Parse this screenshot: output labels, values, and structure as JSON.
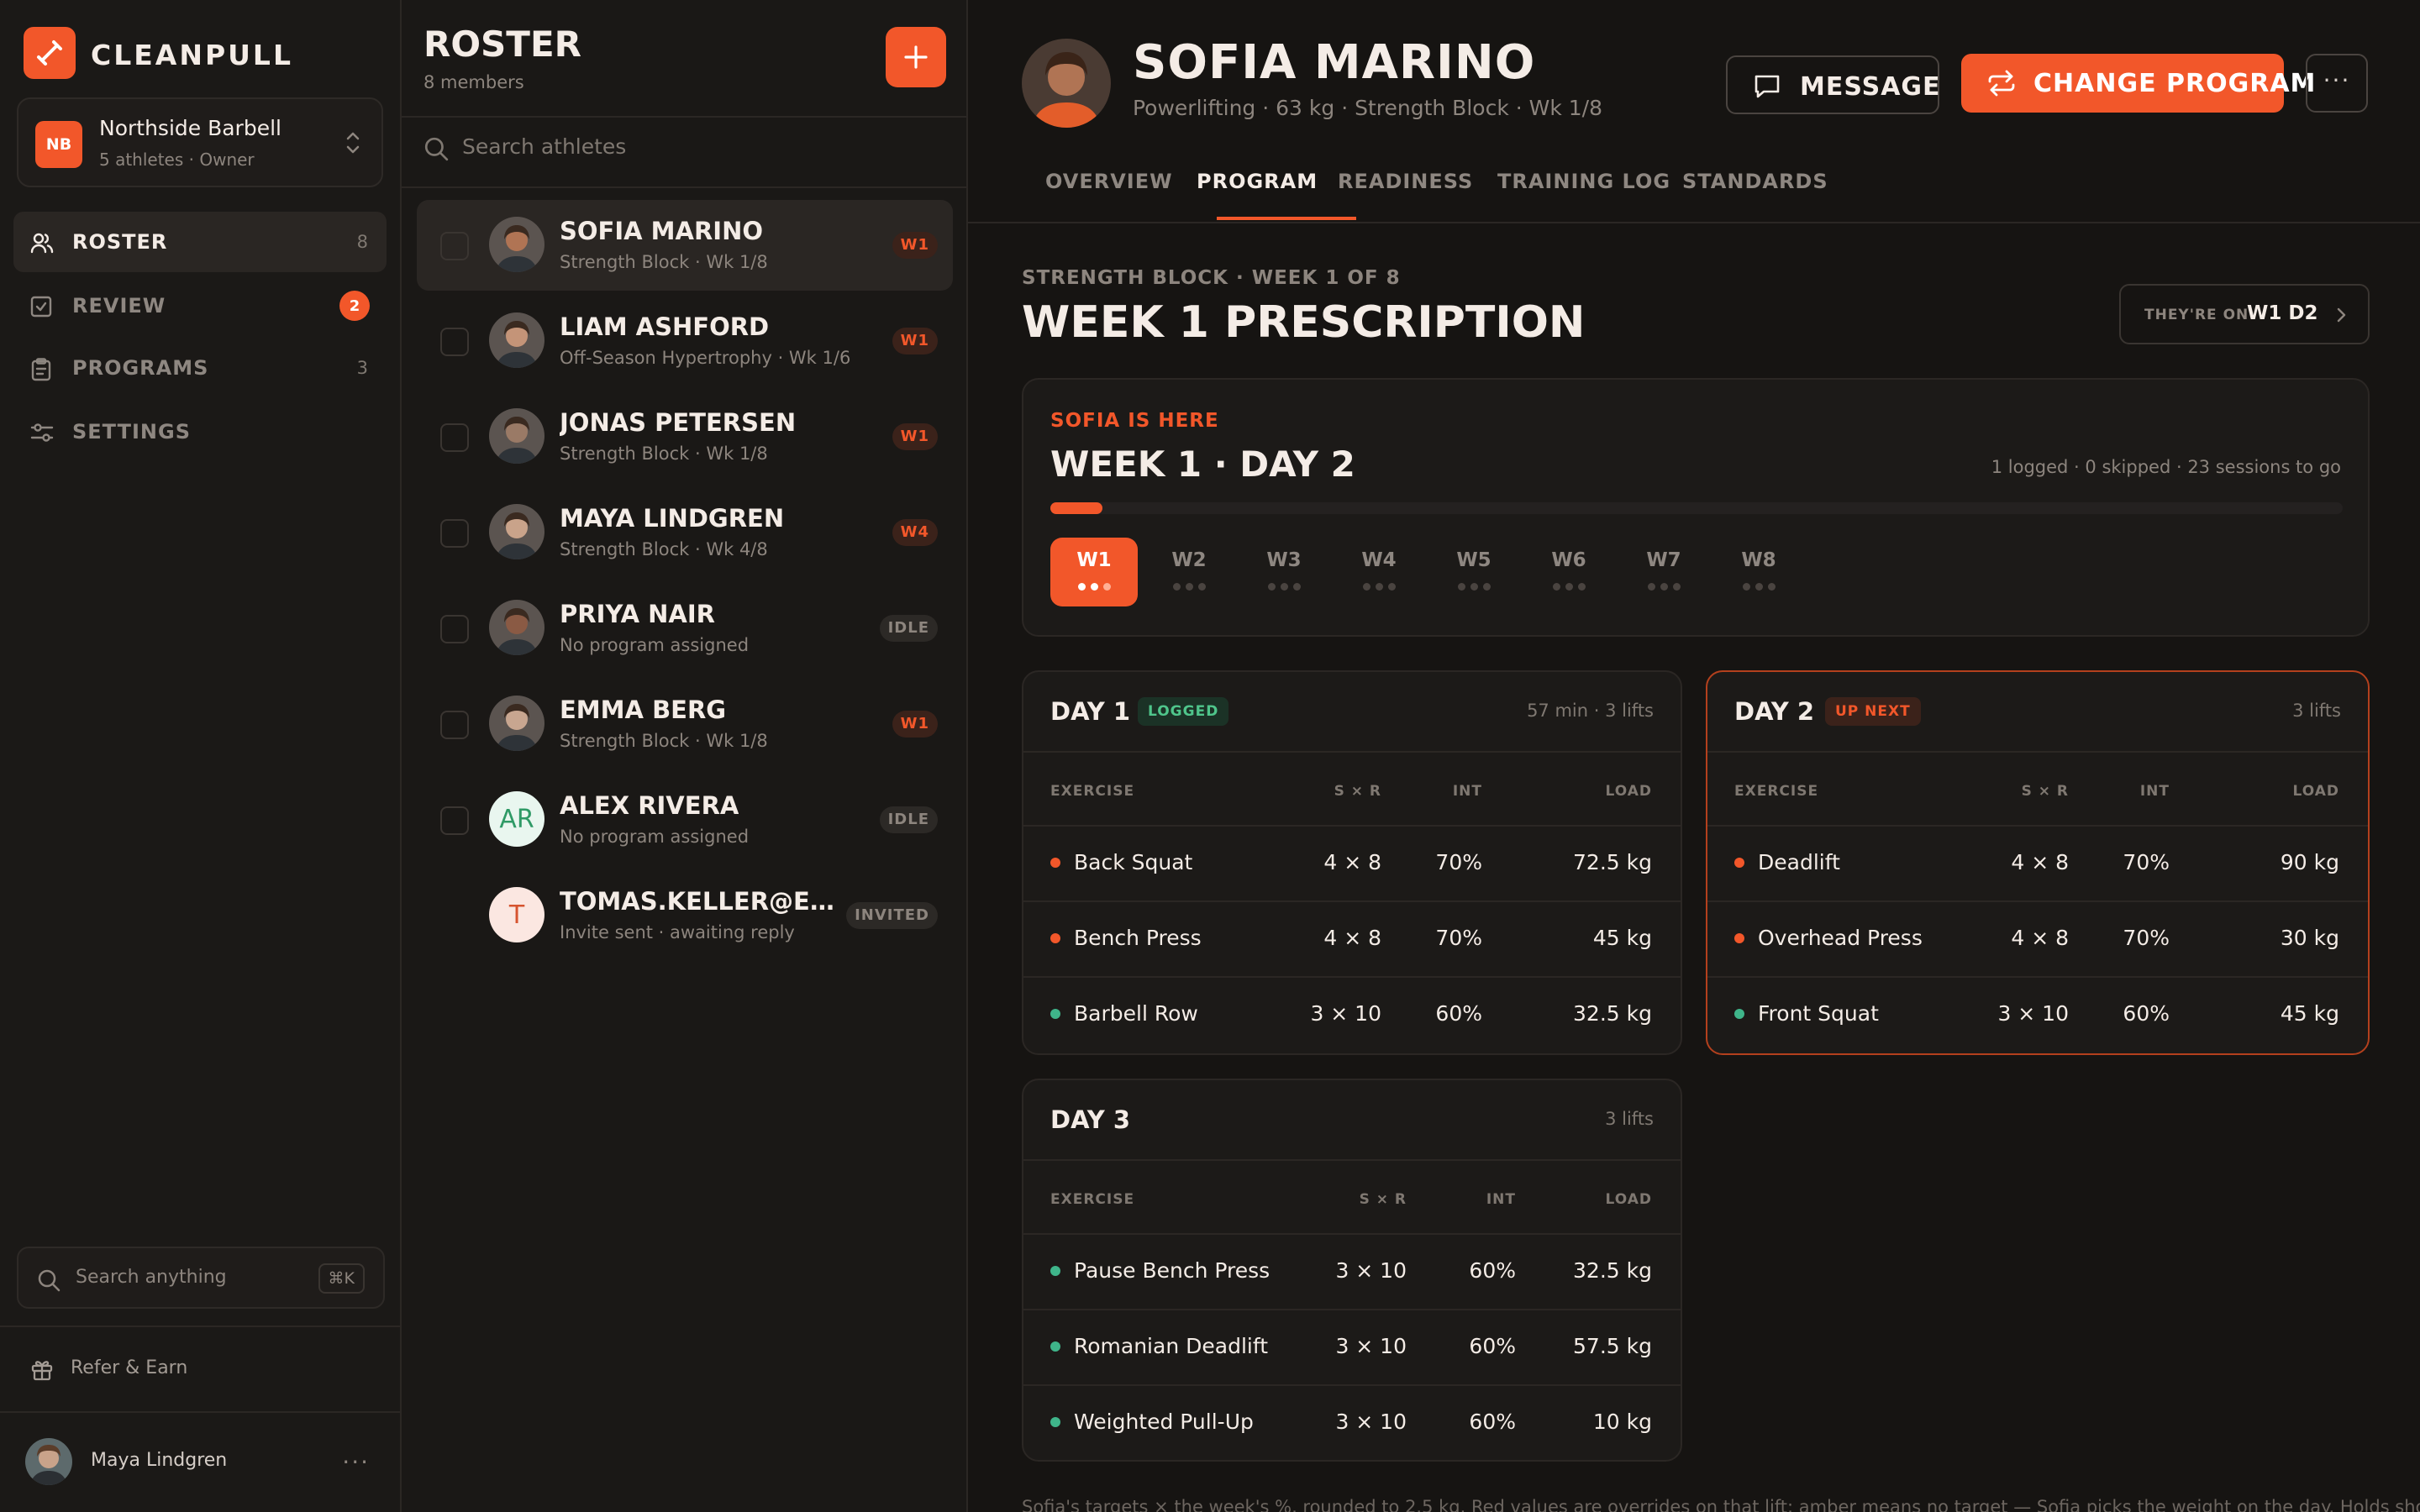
{
  "app": {
    "brand": "CLEANPULL"
  },
  "workspace": {
    "initials": "NB",
    "name": "Northside Barbell",
    "sub": "5 athletes · Owner"
  },
  "nav": [
    {
      "label": "ROSTER",
      "count": "8",
      "icon": "users-icon",
      "active": true
    },
    {
      "label": "REVIEW",
      "badge": "2",
      "icon": "check-square-icon"
    },
    {
      "label": "PROGRAMS",
      "count": "3",
      "icon": "clipboard-icon"
    },
    {
      "label": "SETTINGS",
      "icon": "sliders-icon"
    }
  ],
  "sidebar": {
    "search_placeholder": "Search anything",
    "shortcut": "⌘K",
    "refer": "Refer & Earn",
    "user": "Maya Lindgren",
    "more": "···"
  },
  "roster": {
    "title": "ROSTER",
    "count": "8 members",
    "search_placeholder": "Search athletes",
    "members": [
      {
        "name": "SOFIA MARINO",
        "sub": "Strength Block · Wk 1/8",
        "tag": "W1",
        "tag_kind": "week",
        "selected": true,
        "checkbox": true,
        "avatar": "photo",
        "skin": "#b07454"
      },
      {
        "name": "LIAM ASHFORD",
        "sub": "Off-Season Hypertrophy · Wk 1/6",
        "tag": "W1",
        "tag_kind": "week",
        "checkbox": true,
        "avatar": "photo",
        "skin": "#c49478"
      },
      {
        "name": "JONAS PETERSEN",
        "sub": "Strength Block · Wk 1/8",
        "tag": "W1",
        "tag_kind": "week",
        "checkbox": true,
        "avatar": "photo",
        "skin": "#9a7a66"
      },
      {
        "name": "MAYA LINDGREN",
        "sub": "Strength Block · Wk 4/8",
        "tag": "W4",
        "tag_kind": "week",
        "checkbox": true,
        "avatar": "photo",
        "skin": "#c9a38a"
      },
      {
        "name": "PRIYA NAIR",
        "sub": "No program assigned",
        "tag": "IDLE",
        "tag_kind": "idle",
        "checkbox": true,
        "avatar": "photo",
        "skin": "#8a5a44"
      },
      {
        "name": "EMMA BERG",
        "sub": "Strength Block · Wk 1/8",
        "tag": "W1",
        "tag_kind": "week",
        "checkbox": true,
        "avatar": "photo",
        "skin": "#c8a690"
      },
      {
        "name": "ALEX RIVERA",
        "sub": "No program assigned",
        "tag": "IDLE",
        "tag_kind": "idle",
        "checkbox": true,
        "avatar": "initials",
        "initials": "AR",
        "bg": "#e9f6ef",
        "fg": "#2f9a66"
      },
      {
        "name": "TOMAS.KELLER@EXAMPL...",
        "sub": "Invite sent · awaiting reply",
        "tag": "INVITED",
        "tag_kind": "idle",
        "checkbox": false,
        "avatar": "initials",
        "initials": "T",
        "bg": "#fbe7e1",
        "fg": "#d6542f"
      }
    ]
  },
  "athlete": {
    "name": "SOFIA MARINO",
    "sub": "Powerlifting · 63 kg · Strength Block · Wk 1/8",
    "message_label": "MESSAGE",
    "change_label": "CHANGE PROGRAM",
    "more": "···",
    "tabs": [
      "OVERVIEW",
      "PROGRAM",
      "READINESS",
      "TRAINING LOG",
      "STANDARDS"
    ],
    "active_tab": 1
  },
  "program": {
    "eyebrow": "STRENGTH BLOCK · WEEK 1 OF 8",
    "title": "WEEK 1 PRESCRIPTION",
    "theyre_on_label": "THEY'RE ON",
    "theyre_on_value": "W1 D2"
  },
  "progress_card": {
    "eyebrow": "SOFIA IS HERE",
    "title": "WEEK 1 · DAY 2",
    "stats": "1 logged · 0 skipped · 23 sessions to go",
    "progress_fraction": 0.04,
    "weeks": [
      "W1",
      "W2",
      "W3",
      "W4",
      "W5",
      "W6",
      "W7",
      "W8"
    ],
    "active_week": 0,
    "w1_days_done": 2
  },
  "table_headers": {
    "exercise": "EXERCISE",
    "sxr": "S × R",
    "int": "INT",
    "load": "LOAD"
  },
  "days": [
    {
      "title": "DAY 1",
      "badge": "LOGGED",
      "badge_kind": "logged",
      "meta": "57 min · 3 lifts",
      "rows": [
        {
          "name": "Back Squat",
          "sxr": "4 × 8",
          "int": "70%",
          "load": "72.5 kg",
          "dot": "#f2572a"
        },
        {
          "name": "Bench Press",
          "sxr": "4 × 8",
          "int": "70%",
          "load": "45 kg",
          "dot": "#f2572a"
        },
        {
          "name": "Barbell Row",
          "sxr": "3 × 10",
          "int": "60%",
          "load": "32.5 kg",
          "dot": "#3fb58a"
        }
      ]
    },
    {
      "title": "DAY 2",
      "badge": "UP NEXT",
      "badge_kind": "upnext",
      "meta": "3 lifts",
      "rows": [
        {
          "name": "Deadlift",
          "sxr": "4 × 8",
          "int": "70%",
          "load": "90 kg",
          "dot": "#f2572a"
        },
        {
          "name": "Overhead Press",
          "sxr": "4 × 8",
          "int": "70%",
          "load": "30 kg",
          "dot": "#f2572a"
        },
        {
          "name": "Front Squat",
          "sxr": "3 × 10",
          "int": "60%",
          "load": "45 kg",
          "dot": "#3fb58a"
        }
      ]
    },
    {
      "title": "DAY 3",
      "badge": "",
      "meta": "3 lifts",
      "rows": [
        {
          "name": "Pause Bench Press",
          "sxr": "3 × 10",
          "int": "60%",
          "load": "32.5 kg",
          "dot": "#3fb58a"
        },
        {
          "name": "Romanian Deadlift",
          "sxr": "3 × 10",
          "int": "60%",
          "load": "57.5 kg",
          "dot": "#3fb58a"
        },
        {
          "name": "Weighted Pull-Up",
          "sxr": "3 × 10",
          "int": "60%",
          "load": "10 kg",
          "dot": "#3fb58a"
        }
      ]
    }
  ],
  "footnote": "Sofia's targets × the week's %, rounded to 2.5 kg. Red values are overrides on that lift; amber means no target — Sofia picks the weight on the day. Holds show the"
}
